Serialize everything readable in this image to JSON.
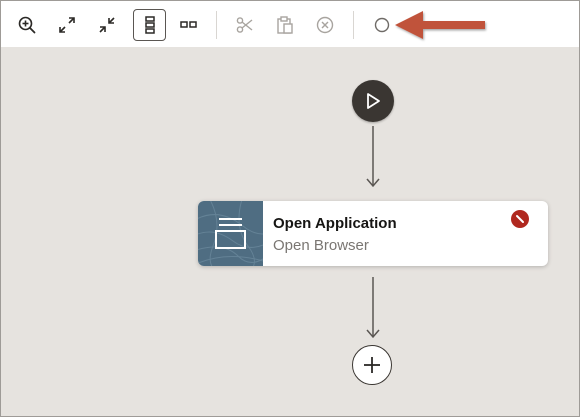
{
  "toolbar": {
    "buttons": [
      {
        "name": "zoom-in",
        "icon": "zoom-in-icon",
        "enabled": true
      },
      {
        "name": "expand",
        "icon": "expand-icon",
        "enabled": true
      },
      {
        "name": "collapse",
        "icon": "collapse-icon",
        "enabled": true
      },
      {
        "name": "vertical-layout",
        "icon": "vertical-layout-icon",
        "enabled": true,
        "selected": true
      },
      {
        "name": "horizontal-layout",
        "icon": "horizontal-layout-icon",
        "enabled": true
      },
      {
        "name": "cut",
        "icon": "scissors-icon",
        "enabled": false
      },
      {
        "name": "paste",
        "icon": "clipboard-icon",
        "enabled": false
      },
      {
        "name": "delete",
        "icon": "delete-circle-icon",
        "enabled": false
      },
      {
        "name": "breakpoint",
        "icon": "circle-icon",
        "enabled": true
      }
    ]
  },
  "flow": {
    "start_node": {
      "icon": "play-icon"
    },
    "steps": [
      {
        "title": "Open Application",
        "subtitle": "Open Browser",
        "icon": "application-icon",
        "status_icon": "error-icon"
      }
    ],
    "add_node": {
      "icon": "plus-icon"
    }
  },
  "colors": {
    "annotation_arrow": "#c0533a",
    "error": "#b0281f",
    "thumb": "#4f6d82",
    "node_dark": "#3a3632",
    "canvas_bg": "#e6e3df"
  }
}
